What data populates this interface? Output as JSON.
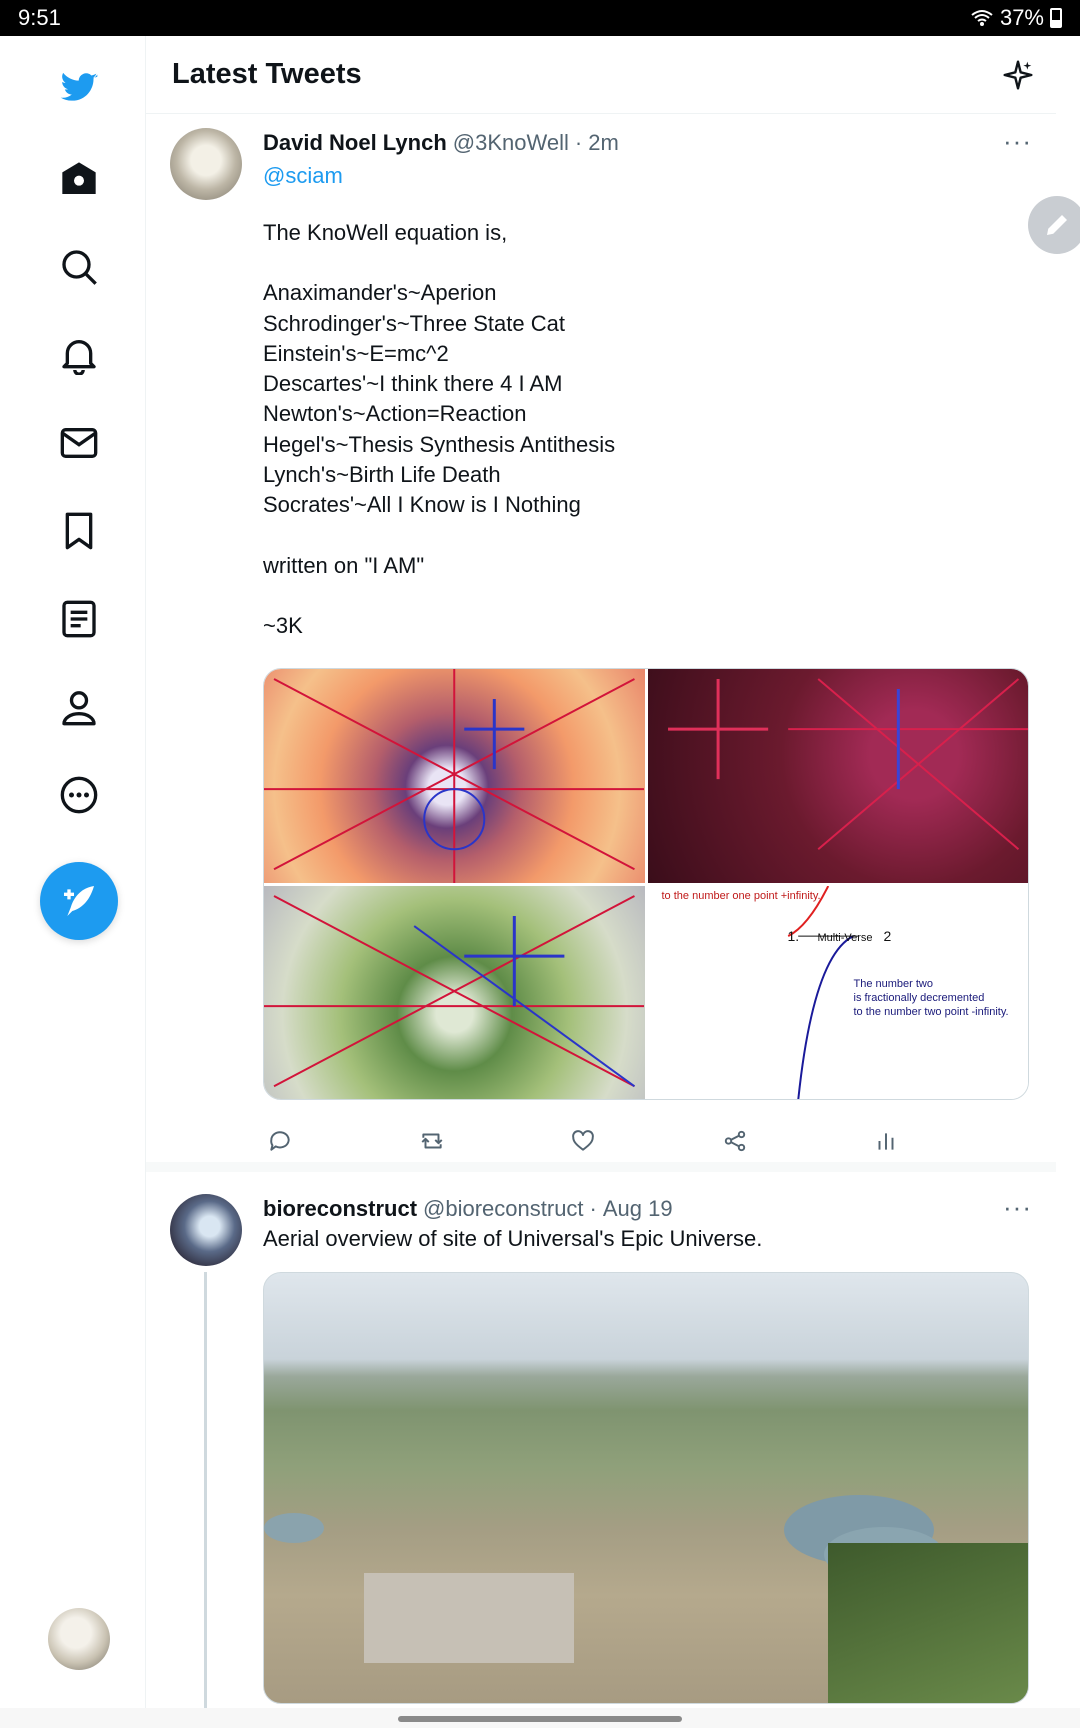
{
  "status_bar": {
    "time": "9:51",
    "battery_percent": "37%"
  },
  "header": {
    "title": "Latest Tweets",
    "sparkle_icon": "sparkle-icon"
  },
  "sidebar": {
    "items": [
      {
        "name": "twitter-logo-icon"
      },
      {
        "name": "home-icon"
      },
      {
        "name": "search-icon"
      },
      {
        "name": "notifications-bell-icon"
      },
      {
        "name": "messages-envelope-icon"
      },
      {
        "name": "bookmark-icon"
      },
      {
        "name": "lists-icon"
      },
      {
        "name": "profile-icon"
      },
      {
        "name": "more-circle-icon"
      }
    ],
    "compose_icon": "compose-feather-icon"
  },
  "tweets": [
    {
      "name": "David Noel Lynch",
      "handle": "@3KnoWell",
      "sep": "·",
      "time": "2m",
      "more": "···",
      "mention": "@sciam",
      "lines": [
        "The KnoWell equation is,",
        "",
        "Anaximander's~Aperion",
        "Schrodinger's~Three State Cat",
        "Einstein's~E=mc^2",
        "Descartes'~I think there 4 I AM",
        "Newton's~Action=Reaction",
        "Hegel's~Thesis Synthesis Antithesis",
        "Lynch's~Birth Life Death",
        "Socrates'~All I Know is I Nothing",
        "",
        "written on \"I AM\"",
        "",
        "~3K"
      ],
      "image4": {
        "top": "to the number one point +infinity.",
        "label_one": "1.",
        "label_multiverse": "Multi-Verse",
        "label_two": "2",
        "caption_1": "The number two",
        "caption_2": "is fractionally decremented",
        "caption_3": "to the number two point -infinity."
      }
    },
    {
      "name": "bioreconstruct",
      "handle": "@bioreconstruct",
      "sep": "·",
      "time": "Aug 19",
      "more": "···",
      "text": "Aerial overview of site of Universal's Epic Universe."
    }
  ],
  "colors": {
    "accent": "#1d9bf0",
    "text": "#0f1419",
    "secondary": "#536471"
  }
}
